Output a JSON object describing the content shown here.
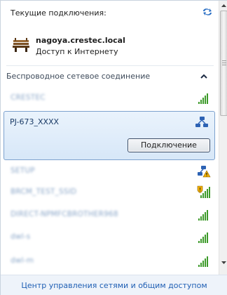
{
  "current_section": {
    "title": "Текущие подключения:",
    "connection": {
      "name": "nagoya.crestec.local",
      "status": "Доступ к Интернету",
      "icon": "bench-network-icon"
    },
    "refresh_icon": "refresh-arrows-icon"
  },
  "wireless_section": {
    "title": "Беспроводное сетевое соединение",
    "collapse_icon": "chevron-up-icon",
    "networks": [
      {
        "label": "CRESTEC",
        "icon": "signal-strength-icon",
        "secured": false
      },
      {
        "label": "PJ-673_XXXX",
        "icon": "adhoc-network-icon",
        "selected": true
      },
      {
        "label": "SETUP",
        "icon": "adhoc-warning-icon"
      },
      {
        "label": "BRCM_TEST_SSID",
        "icon": "signal-warning-icon"
      },
      {
        "label": "DIRECT-NPMFCBROTHER968",
        "icon": "signal-strength-icon"
      },
      {
        "label": "dwl-s",
        "icon": "signal-strength-icon"
      },
      {
        "label": "dwl-m",
        "icon": "signal-strength-icon"
      }
    ],
    "connect_button": "Подключение"
  },
  "footer": {
    "link": "Центр управления сетями и общим доступом"
  },
  "colors": {
    "accent": "#1f5fb4",
    "selected_border": "#7da2ce",
    "signal_green": "#3d9a2a"
  }
}
